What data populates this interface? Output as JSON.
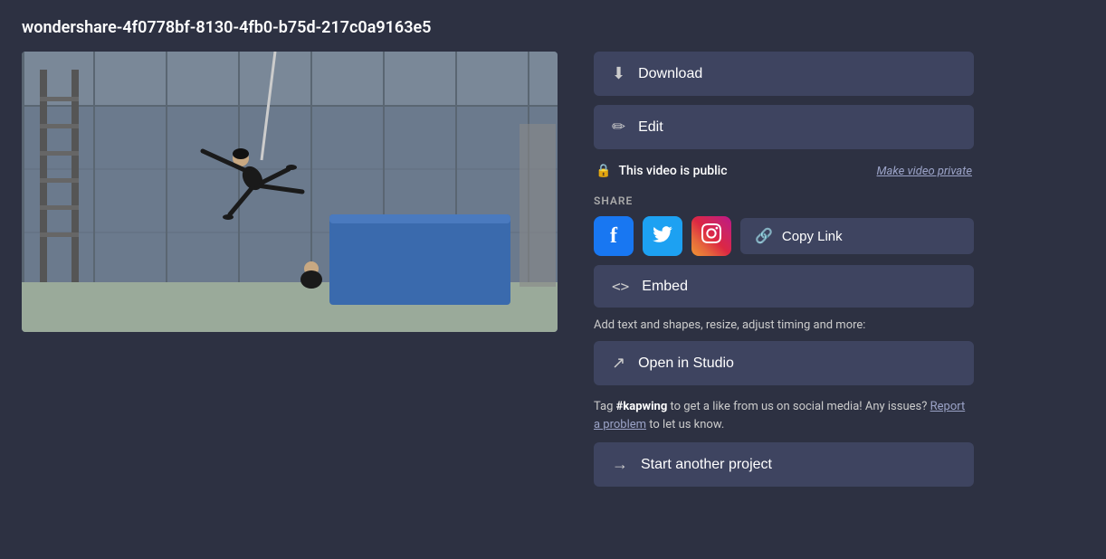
{
  "page": {
    "title": "wondershare-4f0778bf-8130-4fb0-b75d-217c0a9163e5"
  },
  "buttons": {
    "download": "Download",
    "edit": "Edit",
    "embed": "Embed",
    "copyLink": "Copy Link",
    "openInStudio": "Open in Studio",
    "startAnotherProject": "Start another project"
  },
  "privacy": {
    "status": "This video is public",
    "makePrivate": "Make video private"
  },
  "share": {
    "label": "SHARE"
  },
  "studio": {
    "description": "Add text and shapes, resize, adjust timing and more:"
  },
  "social": {
    "tagText": "Tag",
    "tagHandle": "#kapwing",
    "tagSuffix": " to get a like from us on social media! Any issues?",
    "reportLink": "Report a problem",
    "reportSuffix": " to let us know."
  },
  "icons": {
    "download": "⬇",
    "edit": "✏",
    "lock": "🔒",
    "link": "🔗",
    "embed": "<>",
    "external": "↗",
    "arrow": "→",
    "facebook": "f",
    "twitter": "t",
    "instagram": "📷"
  },
  "colors": {
    "bg": "#2d3142",
    "buttonBg": "#3e4460",
    "accent": "#9ba3c7"
  }
}
